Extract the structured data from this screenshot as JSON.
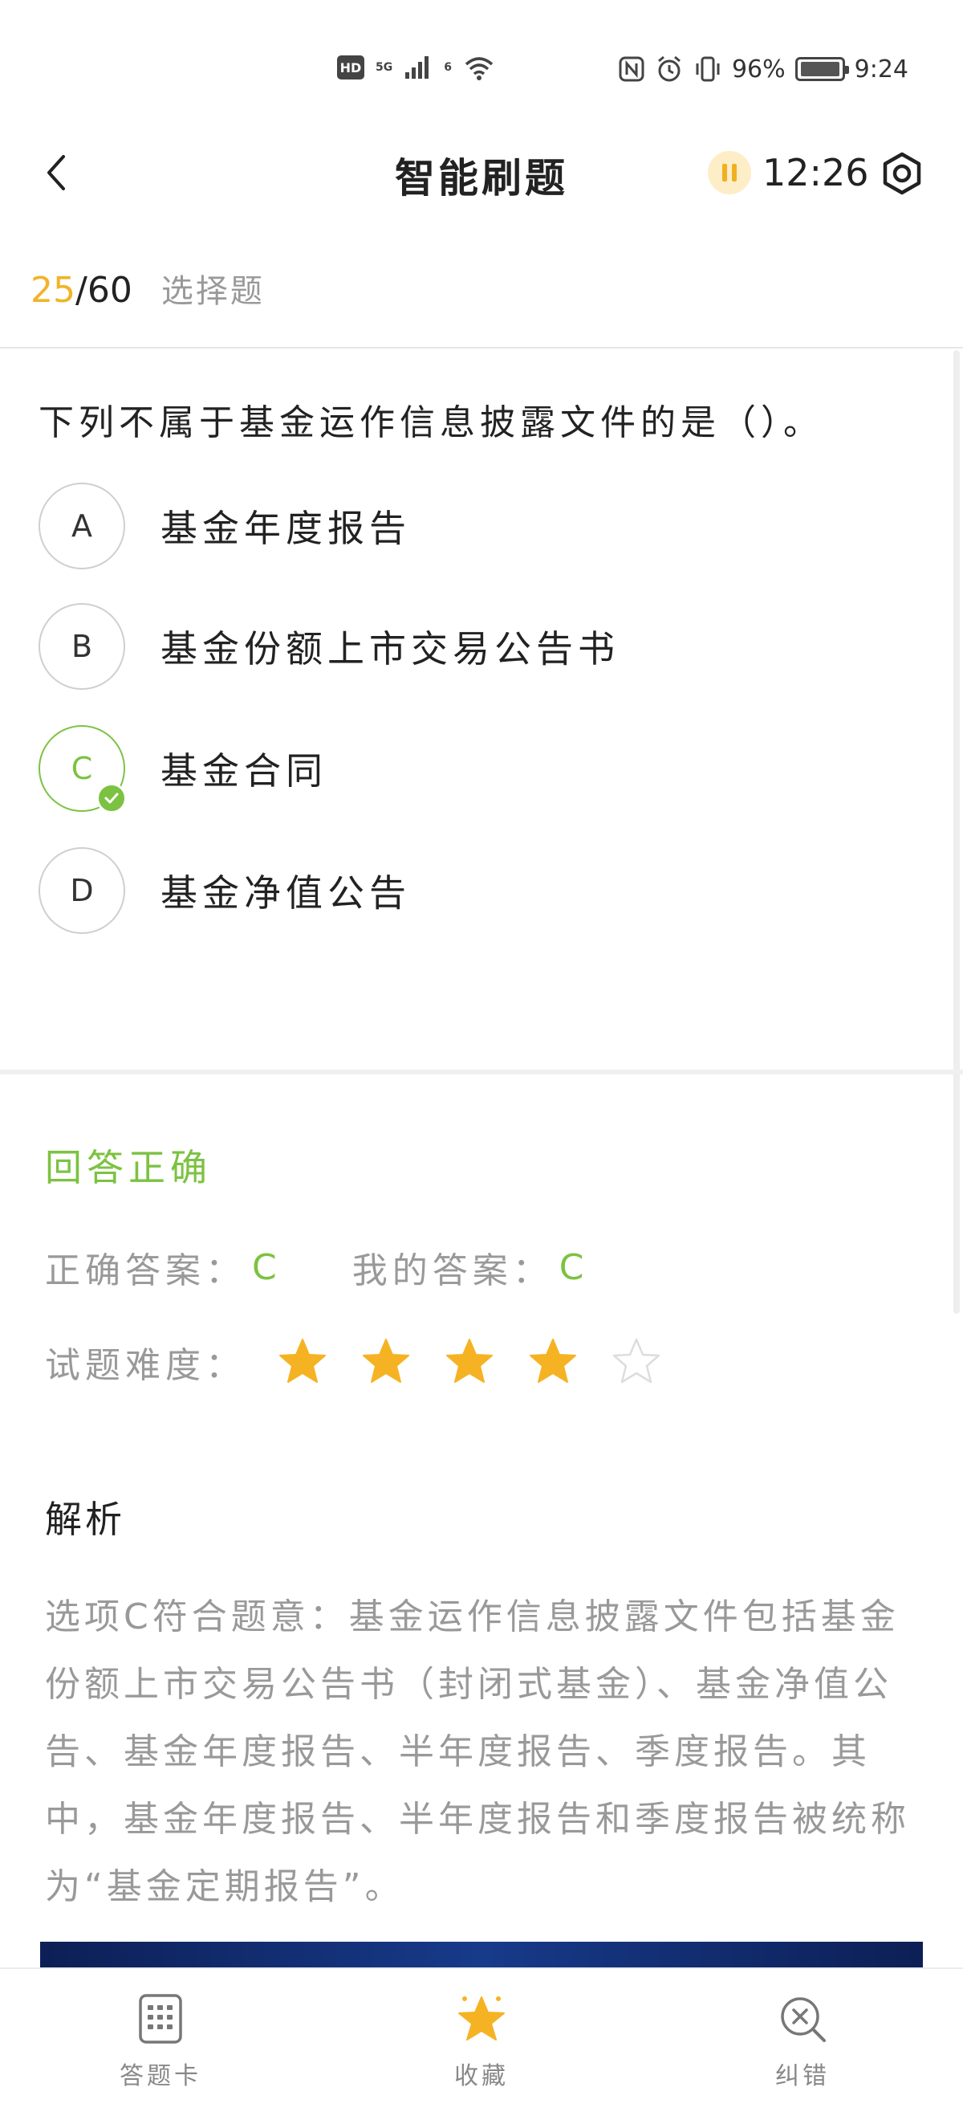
{
  "status_bar": {
    "network": "5G",
    "network2": "6",
    "battery_percent": "96%",
    "time": "9:24"
  },
  "header": {
    "title": "智能刷题",
    "timer": "12:26"
  },
  "progress": {
    "current": "25",
    "separator": "/",
    "total": "60",
    "question_type": "选择题"
  },
  "question": {
    "text": "下列不属于基金运作信息披露文件的是（）。",
    "options": [
      {
        "letter": "A",
        "text": "基金年度报告"
      },
      {
        "letter": "B",
        "text": "基金份额上市交易公告书"
      },
      {
        "letter": "C",
        "text": "基金合同"
      },
      {
        "letter": "D",
        "text": "基金净值公告"
      }
    ]
  },
  "result": {
    "title": "回答正确",
    "correct_label": "正确答案：",
    "correct_value": "C",
    "mine_label": "我的答案：",
    "mine_value": "C",
    "difficulty_label": "试题难度：",
    "difficulty_rating": 4,
    "difficulty_max": 5,
    "star_fill_color": "#f5b323",
    "star_empty_color": "#dddddd"
  },
  "analysis": {
    "title": "解析",
    "text": "选项C符合题意：基金运作信息披露文件包括基金份额上市交易公告书（封闭式基金）、基金净值公告、基金年度报告、半年度报告、季度报告。其中，基金年度报告、半年度报告和季度报告被统称为“基金定期报告”。"
  },
  "bottom_tabs": [
    {
      "label": "答题卡",
      "icon": "answer-card-icon"
    },
    {
      "label": "收藏",
      "icon": "star-icon"
    },
    {
      "label": "纠错",
      "icon": "error-search-icon"
    }
  ],
  "colors": {
    "accent_green": "#7cc242",
    "accent_yellow": "#f0b429"
  }
}
